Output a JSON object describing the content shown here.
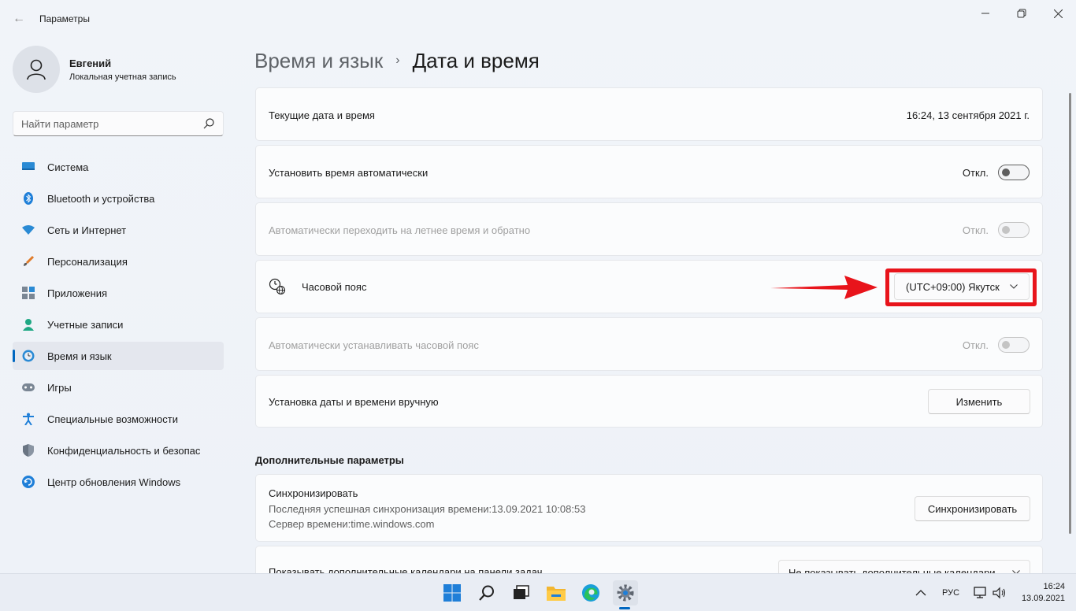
{
  "window": {
    "title": "Параметры",
    "back_icon": "back-arrow-icon",
    "controls": [
      "minimize-icon",
      "maximize-icon",
      "close-icon"
    ]
  },
  "profile": {
    "name": "Евгений",
    "account_type": "Локальная учетная запись"
  },
  "search": {
    "placeholder": "Найти параметр",
    "icon": "search-icon"
  },
  "sidebar": {
    "items": [
      {
        "label": "Система",
        "icon": "system-icon"
      },
      {
        "label": "Bluetooth и устройства",
        "icon": "bluetooth-icon"
      },
      {
        "label": "Сеть и Интернет",
        "icon": "wifi-icon"
      },
      {
        "label": "Персонализация",
        "icon": "brush-icon"
      },
      {
        "label": "Приложения",
        "icon": "apps-icon"
      },
      {
        "label": "Учетные записи",
        "icon": "account-icon"
      },
      {
        "label": "Время и язык",
        "icon": "time-language-icon",
        "active": true
      },
      {
        "label": "Игры",
        "icon": "gamepad-icon"
      },
      {
        "label": "Специальные возможности",
        "icon": "accessibility-icon"
      },
      {
        "label": "Конфиденциальность и безопас",
        "icon": "shield-icon"
      },
      {
        "label": "Центр обновления Windows",
        "icon": "update-icon"
      }
    ]
  },
  "breadcrumb": {
    "parent": "Время и язык",
    "separator": "›",
    "current": "Дата и время"
  },
  "settings": {
    "current_datetime": {
      "label": "Текущие дата и время",
      "value": "16:24, 13 сентября 2021 г."
    },
    "auto_time": {
      "label": "Установить время автоматически",
      "state": "Откл."
    },
    "dst": {
      "label": "Автоматически переходить на летнее время и обратно",
      "state": "Откл."
    },
    "timezone": {
      "label": "Часовой пояс",
      "value": "(UTC+09:00) Якутск",
      "icon": "globe-clock-icon"
    },
    "auto_timezone": {
      "label": "Автоматически устанавливать часовой пояс",
      "state": "Откл."
    },
    "manual": {
      "label": "Установка даты и времени вручную",
      "button": "Изменить"
    }
  },
  "additional": {
    "section_title": "Дополнительные параметры",
    "sync": {
      "title": "Синхронизировать",
      "last_sync": "Последняя успешная синхронизация времени:13.09.2021 10:08:53",
      "server": "Сервер времени:time.windows.com",
      "button": "Синхронизировать"
    },
    "calendars": {
      "label": "Показывать дополнительные календари на панели задач",
      "value": "Не показывать дополнительные календари"
    }
  },
  "colors": {
    "accent": "#0067c0",
    "highlight": "#e8141b"
  },
  "taskbar": {
    "icons": [
      "windows-start-icon",
      "search-icon",
      "task-view-icon",
      "file-explorer-icon",
      "edge-icon",
      "settings-icon"
    ],
    "tray_icons": [
      "chevron-up-icon",
      "network-icon",
      "volume-icon"
    ],
    "language": "РУС",
    "time": "16:24",
    "date": "13.09.2021"
  }
}
